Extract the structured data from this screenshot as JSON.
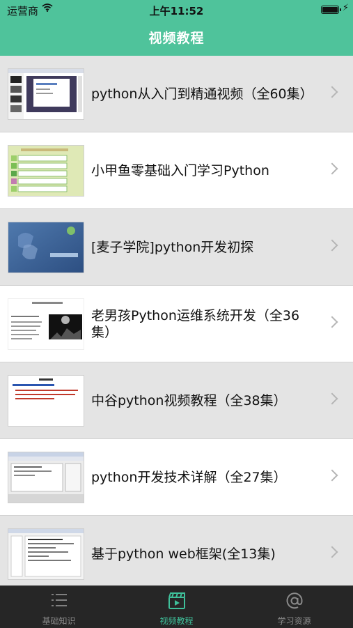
{
  "status_bar": {
    "carrier": "运营商",
    "time": "上午11:52"
  },
  "nav": {
    "title": "视频教程"
  },
  "videos": [
    {
      "title": "python从入门到精通视频（全60集）"
    },
    {
      "title": "小甲鱼零基础入门学习Python"
    },
    {
      "title": "[麦子学院]python开发初探"
    },
    {
      "title": "老男孩Python运维系统开发（全36集）"
    },
    {
      "title": "中谷python视频教程（全38集）"
    },
    {
      "title": "python开发技术详解（全27集）"
    },
    {
      "title": "基于python web框架(全13集)"
    }
  ],
  "tabs": [
    {
      "label": "基础知识",
      "icon": "list-icon"
    },
    {
      "label": "视频教程",
      "icon": "video-icon"
    },
    {
      "label": "学习资源",
      "icon": "at-icon"
    }
  ],
  "colors": {
    "header": "#4fc39b",
    "tab_active": "#3fc09a",
    "tab_bar": "#262626"
  }
}
